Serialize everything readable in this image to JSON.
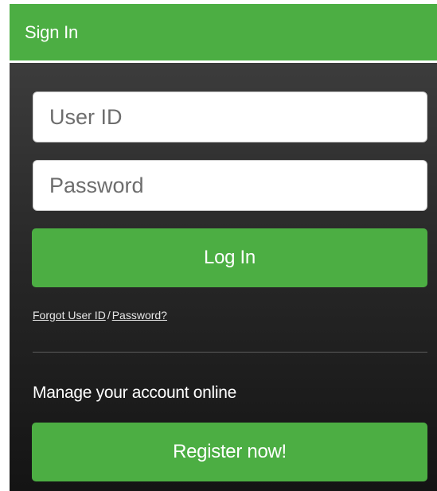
{
  "header": {
    "title": "Sign In"
  },
  "form": {
    "userid_placeholder": "User ID",
    "password_placeholder": "Password",
    "login_label": "Log In",
    "forgot_userid_label": "Forgot User ID",
    "forgot_separator": "/",
    "forgot_password_label": "Password?"
  },
  "register": {
    "prompt": "Manage your account online",
    "button_label": "Register now!"
  },
  "colors": {
    "accent_green": "#4cae43",
    "panel_dark": "#262626"
  }
}
